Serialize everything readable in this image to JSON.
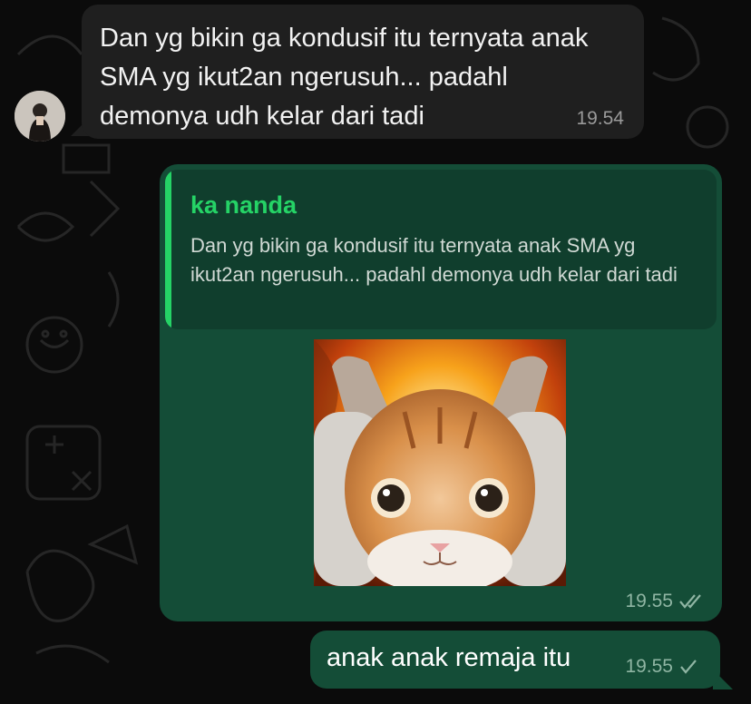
{
  "chat": {
    "incoming_message": {
      "sender": "ka nanda",
      "text": "Dan yg bikin ga kondusif itu ternyata anak SMA yg ikut2an ngerusuh... padahl demonya udh kelar dari tadi",
      "time": "19.54"
    },
    "reply_message": {
      "quoted_sender": "ka nanda",
      "quoted_text": "Dan yg bikin ga kondusif itu ternyata anak SMA yg ikut2an ngerusuh... padahl demonya udh kelar dari tadi",
      "attachment": "cat-sticker-fire",
      "time": "19.55",
      "status": "double-check-icon"
    },
    "outgoing_message": {
      "text": "anak anak remaja itu",
      "time": "19.55",
      "status": "check-icon"
    }
  },
  "colors": {
    "background": "#0b0b0b",
    "incoming_bubble": "#1f1f1f",
    "outgoing_bubble": "#144d37",
    "quote_accent": "#25d366"
  }
}
